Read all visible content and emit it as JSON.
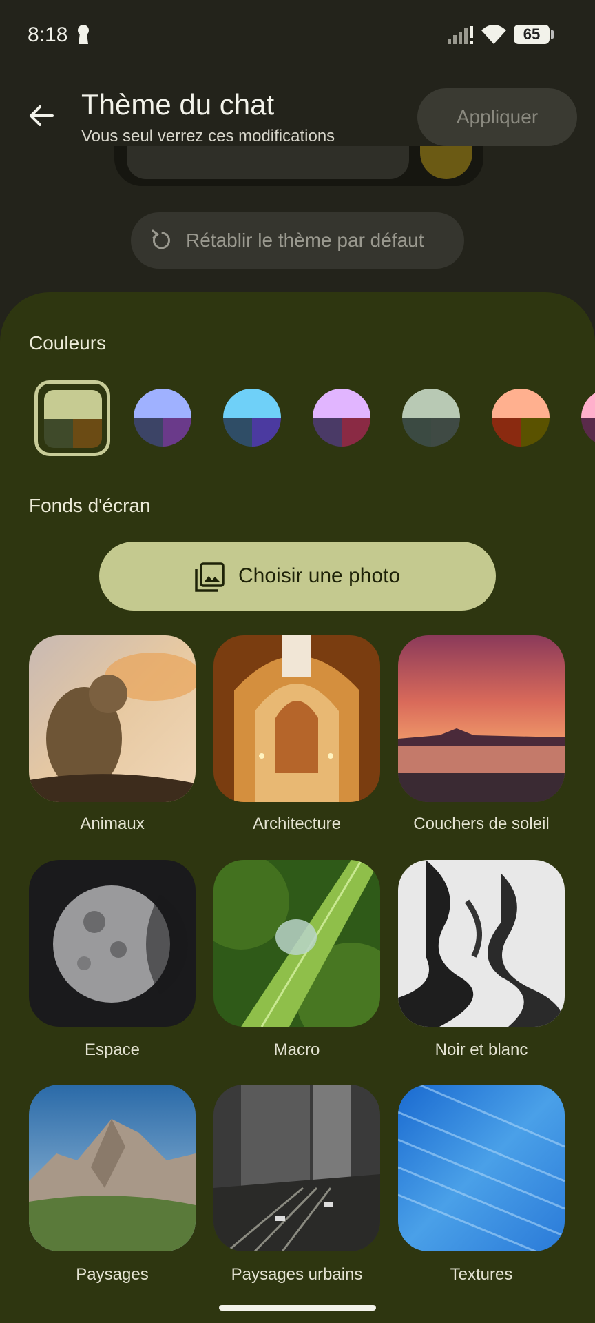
{
  "status_bar": {
    "time": "8:18",
    "battery": "65"
  },
  "header": {
    "title": "Thème du chat",
    "subtitle": "Vous seul verrez ces modifications",
    "apply_label": "Appliquer",
    "reset_label": "Rétablir le thème par défaut"
  },
  "sheet": {
    "colors_title": "Couleurs",
    "wallpapers_title": "Fonds d'écran",
    "choose_photo_label": "Choisir une photo",
    "swatches": [
      {
        "top": "#c6cb92",
        "bottom_left": "#3f4a2a",
        "bottom_right": "#6b4b14",
        "selected": true
      },
      {
        "top": "#9fb1ff",
        "bottom_left": "#3c4466",
        "bottom_right": "#6a3a8a",
        "selected": false
      },
      {
        "top": "#6fd0f8",
        "bottom_left": "#2f4d66",
        "bottom_right": "#4b3aa0",
        "selected": false
      },
      {
        "top": "#e1b5ff",
        "bottom_left": "#4a3a66",
        "bottom_right": "#8a2a44",
        "selected": false
      },
      {
        "top": "#b8c9b4",
        "bottom_left": "#3b4a42",
        "bottom_right": "#3f4a44",
        "selected": false
      },
      {
        "top": "#ffb08f",
        "bottom_left": "#8a2a10",
        "bottom_right": "#5a5200",
        "selected": false
      },
      {
        "top": "#ffb0cc",
        "bottom_left": "#5a2a4a",
        "bottom_right": "#5a2a4a",
        "selected": false
      }
    ],
    "wallpapers": [
      {
        "label": "Animaux"
      },
      {
        "label": "Architecture"
      },
      {
        "label": "Couchers de soleil"
      },
      {
        "label": "Espace"
      },
      {
        "label": "Macro"
      },
      {
        "label": "Noir et blanc"
      },
      {
        "label": "Paysages"
      },
      {
        "label": "Paysages urbains"
      },
      {
        "label": "Textures"
      }
    ]
  }
}
